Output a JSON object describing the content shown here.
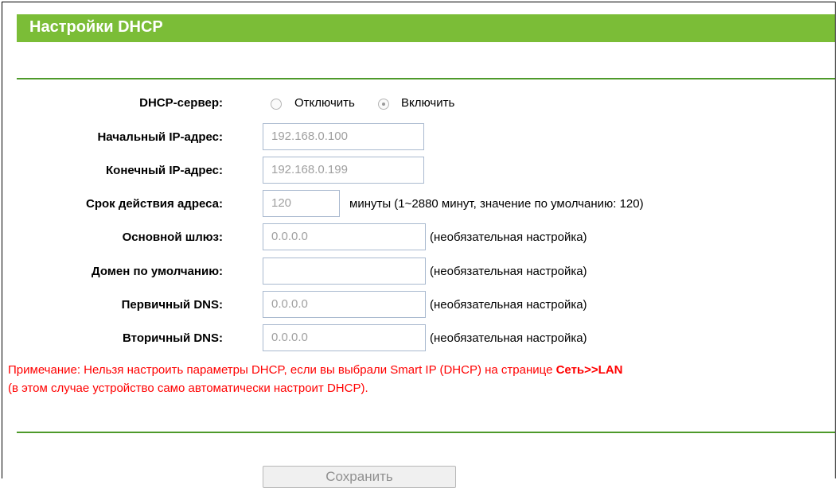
{
  "title": "Настройки DHCP",
  "dhcp_server": {
    "label": "DHCP-сервер:",
    "option_off": "Отключить",
    "option_on": "Включить",
    "selected": "Включить"
  },
  "start_ip": {
    "label": "Начальный IP-адрес:",
    "value": "192.168.0.100"
  },
  "end_ip": {
    "label": "Конечный IP-адрес:",
    "value": "192.168.0.199"
  },
  "lease_time": {
    "label": "Срок действия адреса:",
    "value": "120",
    "hint": "минуты (1~2880 минут, значение по умолчанию: 120)"
  },
  "gateway": {
    "label": "Основной шлюз:",
    "value": "0.0.0.0",
    "hint": "(необязательная настройка)"
  },
  "default_domain": {
    "label": "Домен по умолчанию:",
    "value": "",
    "hint": "(необязательная настройка)"
  },
  "primary_dns": {
    "label": "Первичный DNS:",
    "value": "0.0.0.0",
    "hint": "(необязательная настройка)"
  },
  "secondary_dns": {
    "label": "Вторичный DNS:",
    "value": "0.0.0.0",
    "hint": "(необязательная настройка)"
  },
  "note": {
    "line1_prefix": "Примечание: Нельзя настроить параметры DHCP, если вы выбрали Smart IP (DHCP) на странице ",
    "line1_link": "Сеть>>LAN",
    "line2": "(в этом случае устройство само автоматически настроит DHCP)."
  },
  "save_label": "Сохранить",
  "colors": {
    "title_bar": "#7bbd37",
    "rule": "#4e9a2a",
    "note_text": "#ff0000",
    "field_border": "#a9b9cf"
  }
}
